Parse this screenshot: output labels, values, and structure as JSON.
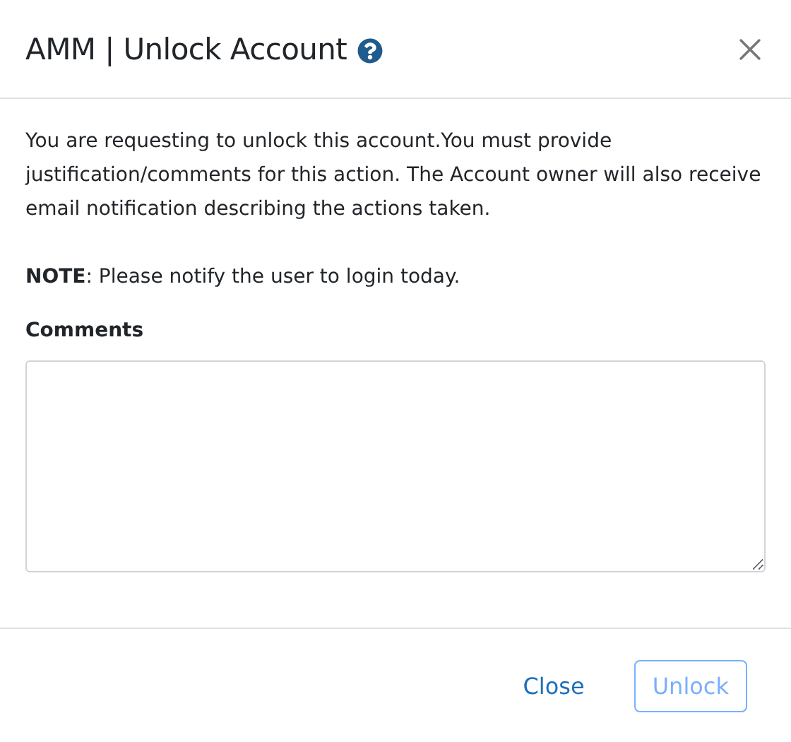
{
  "dialog": {
    "title": "AMM | Unlock Account",
    "message": "You are requesting to unlock this account.You must provide justification/comments for this action. The Account owner will also receive email notification describing the actions taken.",
    "note": "**NOTE**: Please notify the user to login today.",
    "comments": {
      "label": "Comments"
    },
    "buttons": [
      {
        "kind": "link",
        "label": "Close",
        "disabled": false
      },
      {
        "kind": "outline",
        "label": "Unlock",
        "disabled": true
      }
    ]
  }
}
